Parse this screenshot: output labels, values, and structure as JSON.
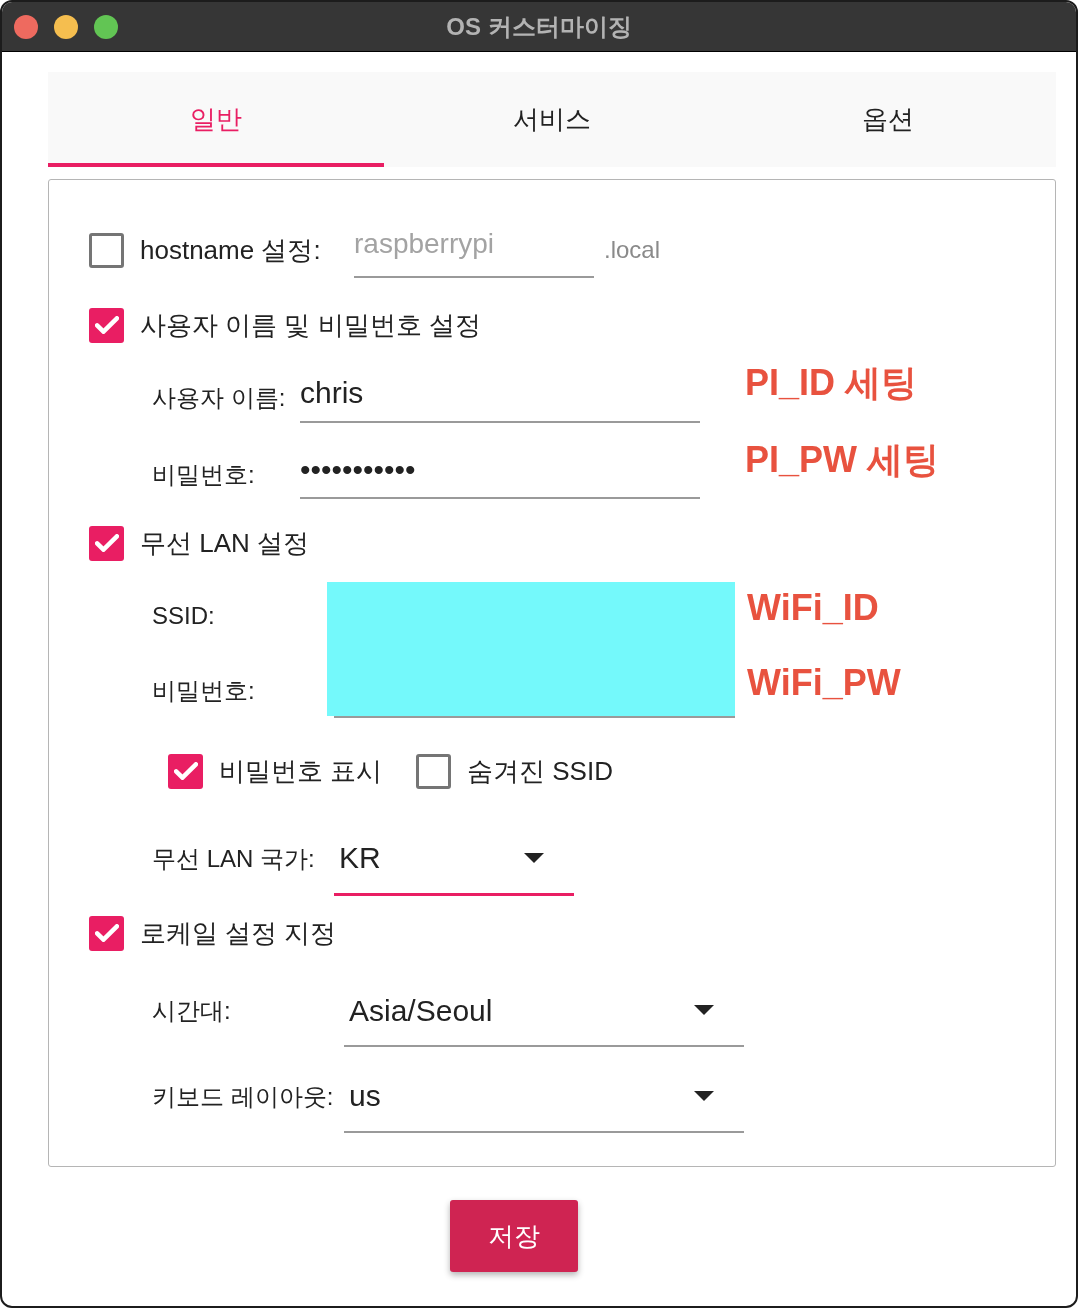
{
  "window": {
    "title": "OS 커스터마이징"
  },
  "tabs": [
    {
      "label": "일반",
      "selected": true
    },
    {
      "label": "서비스",
      "selected": false
    },
    {
      "label": "옵션",
      "selected": false
    }
  ],
  "general": {
    "hostname": {
      "checked": false,
      "label": "hostname 설정:",
      "placeholder": "raspberrypi",
      "suffix": ".local"
    },
    "user": {
      "checked": true,
      "label": "사용자 이름 및 비밀번호 설정",
      "fields": [
        {
          "label": "사용자 이름:",
          "value": "chris",
          "annotation": "PI_ID 세팅"
        },
        {
          "label": "비밀번호:",
          "value": "•••••••••••",
          "annotation": "PI_PW 세팅"
        }
      ]
    },
    "wireless": {
      "checked": true,
      "label": "무선 LAN 설정",
      "redacted": true,
      "fields": [
        {
          "label": "SSID:",
          "annotation": "WiFi_ID"
        },
        {
          "label": "비밀번호:",
          "annotation": "WiFi_PW"
        }
      ],
      "options": [
        {
          "label": "비밀번호 표시",
          "checked": true
        },
        {
          "label": "숨겨진 SSID",
          "checked": false
        }
      ],
      "country": {
        "label": "무선 LAN 국가:",
        "value": "KR",
        "focused": true
      }
    },
    "locale": {
      "checked": true,
      "label": "로케일 설정 지정",
      "selects": [
        {
          "label": "시간대:",
          "value": "Asia/Seoul"
        },
        {
          "label": "키보드 레이아웃:",
          "value": "us"
        }
      ]
    }
  },
  "buttons": [
    {
      "label": "저장"
    }
  ]
}
